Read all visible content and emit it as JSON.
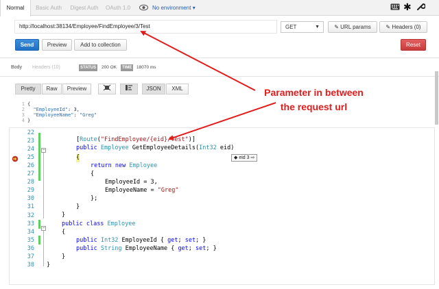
{
  "topbar": {
    "tabs": [
      "Normal",
      "Basic Auth",
      "Digest Auth",
      "OAuth 1.0"
    ],
    "environment": "No environment ▾",
    "icons": [
      "keyboard-icon",
      "asterisk-icon",
      "wrench-icon",
      "eye-icon"
    ]
  },
  "request": {
    "url": "http://localhost:38134/Employee/FindEmployee/3/Test",
    "method": "GET",
    "url_params_label": "URL params",
    "headers_label": "Headers (0)"
  },
  "actions": {
    "send": "Send",
    "preview": "Preview",
    "add_to_collection": "Add to collection",
    "reset": "Reset"
  },
  "response": {
    "tabs": [
      "Body",
      "Headers (10)"
    ],
    "status_label": "STATUS",
    "status_value": "200 OK",
    "time_label": "TIME",
    "time_value": "18070 ms",
    "format_buttons": [
      "Pretty",
      "Raw",
      "Preview",
      "JSON",
      "XML"
    ],
    "json_lines": [
      {
        "n": "1",
        "text": "{"
      },
      {
        "n": "2",
        "key": "\"EmployeeId\"",
        "rest": ": 3,"
      },
      {
        "n": "3",
        "key": "\"EmployeeName\"",
        "rest": ": ",
        "str": "\"Greg\""
      },
      {
        "n": "4",
        "text": "}"
      }
    ]
  },
  "annotation": {
    "line1": "Parameter in between",
    "line2": "the request url"
  },
  "code": {
    "line_numbers": [
      "22",
      "23",
      "24",
      "25",
      "26",
      "27",
      "28",
      "29",
      "30",
      "31",
      "32",
      "33",
      "34",
      "35",
      "36",
      "37",
      "38"
    ],
    "datatip": "eid 3",
    "lines": {
      "l23_a": "[",
      "l23_route": "Route",
      "l23_b": "(",
      "l23_str": "\"FindEmployee/{eid}/Test\"",
      "l23_c": ")]",
      "l24_pub": "public",
      "l24_ty": "Employee",
      "l24_name": " GetEmployeeDetails(",
      "l24_int": "Int32",
      "l24_end": " eid)",
      "l25": "{",
      "l26_ret": "return",
      "l26_new": " new",
      "l26_ty": " Employee",
      "l27": "{",
      "l28": "EmployeeId = 3,",
      "l29_a": "EmployeeName = ",
      "l29_str": "\"Greg\"",
      "l30": "};",
      "l31": "}",
      "l32": "}",
      "l33_pub": "public",
      "l33_cls": " class",
      "l33_ty": " Employee",
      "l34": "{",
      "l35_pub": "public",
      "l35_ty": " Int32",
      "l35_name": " EmployeeId { ",
      "l35_get": "get",
      "l35_mid": "; ",
      "l35_set": "set",
      "l35_end": "; }",
      "l36_pub": "public",
      "l36_ty": " String",
      "l36_name": " EmployeeName { ",
      "l36_get": "get",
      "l36_mid": "; ",
      "l36_set": "set",
      "l36_end": "; }",
      "l37": "}",
      "l38": "}"
    }
  },
  "colors": {
    "annotation": "#e31c1c",
    "send": "#1f6fc4",
    "reset": "#c83a3a",
    "keyword": "#0000ff",
    "type": "#2b91af",
    "string": "#a31515"
  }
}
